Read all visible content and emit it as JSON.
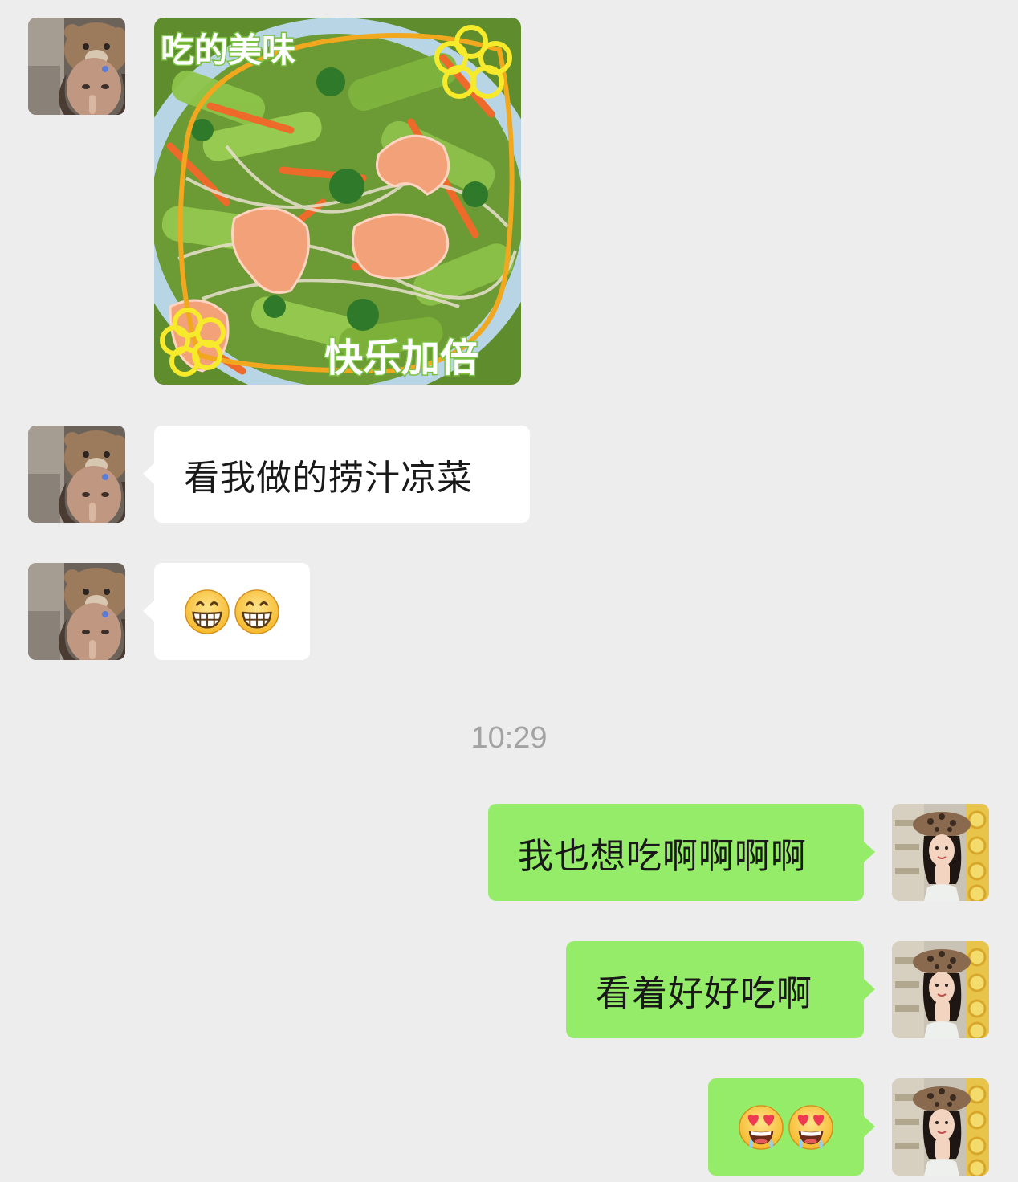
{
  "chat": {
    "timestamp": "10:29",
    "incoming": {
      "photo": {
        "caption_top": "吃的美味",
        "caption_bottom": "快乐加倍"
      },
      "text_message": "看我做的捞汁凉菜",
      "emoji_message": {
        "emoji": "grinning-face-with-teeth",
        "count": 2
      }
    },
    "outgoing": {
      "message_1": "我也想吃啊啊啊啊",
      "message_2": "看着好好吃啊",
      "emoji_message": {
        "emoji": "heart-eyes-drooling-face",
        "count": 2
      }
    }
  },
  "colors": {
    "background": "#ededed",
    "incoming_bubble": "#ffffff",
    "outgoing_bubble": "#95ec69",
    "timestamp_text": "#a3a3a3"
  }
}
